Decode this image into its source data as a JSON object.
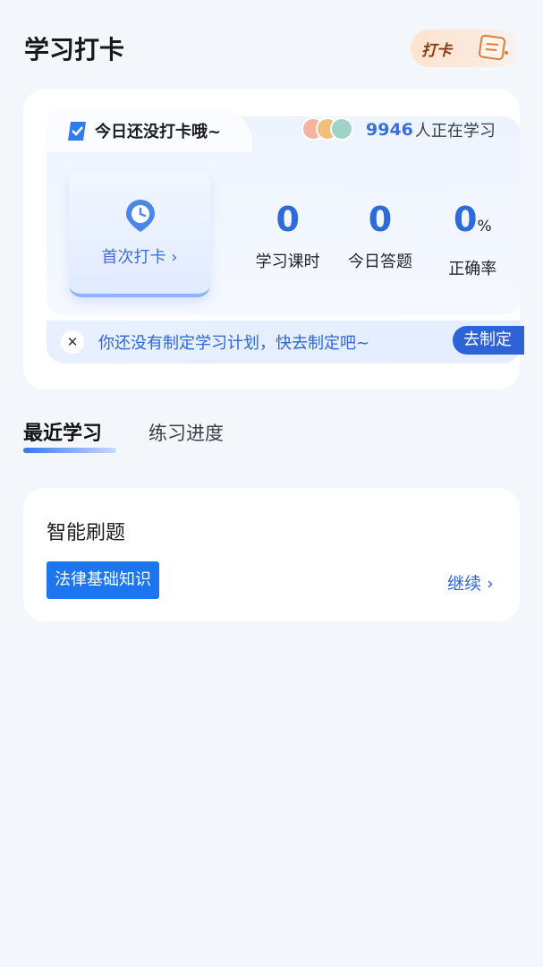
{
  "header": {
    "title": "学习打卡",
    "checkin_badge": "打卡"
  },
  "checkin_card": {
    "status": "今日还没打卡哦~",
    "learners_count": "9946",
    "learners_suffix": "人正在学习",
    "first_checkin_label": "首次打卡",
    "first_checkin_arrow": "›",
    "stats": [
      {
        "value": "0",
        "unit": "",
        "label": "学习课时"
      },
      {
        "value": "0",
        "unit": "",
        "label": "今日答题"
      },
      {
        "value": "0",
        "unit": "%",
        "label": "正确率"
      }
    ],
    "plan": {
      "close": "✕",
      "text": "你还没有制定学习计划，快去制定吧~",
      "button": "去制定"
    }
  },
  "tabs": [
    {
      "label": "最近学习",
      "active": true
    },
    {
      "label": "练习进度",
      "active": false
    }
  ],
  "recent": {
    "title": "智能刷题",
    "subject_tag": "法律基础知识",
    "continue_label": "继续",
    "continue_arrow": "›"
  },
  "colors": {
    "accent": "#2e63d8",
    "tag_blue": "#1d75ef",
    "background": "#f3f6fb"
  }
}
